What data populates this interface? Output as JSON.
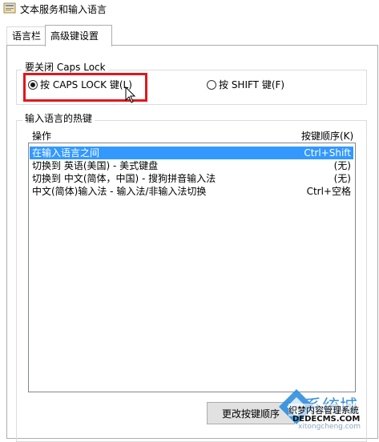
{
  "window": {
    "title": "文本服务和输入语言"
  },
  "tabs": [
    {
      "label": "语言栏",
      "active": false
    },
    {
      "label": "高级键设置",
      "active": true
    }
  ],
  "caps_lock_group": {
    "legend": "要关闭 Caps Lock",
    "option_caps": {
      "label": "按 CAPS LOCK 键(L)",
      "selected": true
    },
    "option_shift": {
      "label": "按 SHIFT 键(F)",
      "selected": false
    }
  },
  "hotkeys_group": {
    "legend": "输入语言的热键",
    "col_action": "操作",
    "col_sequence": "按键顺序(K)",
    "rows": [
      {
        "action": "在输入语言之间",
        "keys": "Ctrl+Shift",
        "selected": true
      },
      {
        "action": "切换到 英语(美国) - 美式键盘",
        "keys": "(无)",
        "selected": false
      },
      {
        "action": "切换到 中文(简体，中国) - 搜狗拼音输入法",
        "keys": "(无)",
        "selected": false
      },
      {
        "action": "中文(简体)输入法 - 输入法/非输入法切换",
        "keys": "Ctrl+空格",
        "selected": false
      }
    ]
  },
  "change_button": {
    "label": "更改按键顺序"
  },
  "watermark": {
    "brand_cn": "系统城",
    "brand_en": "xitongcheng.com",
    "site_cn": "织梦内容管理系统",
    "domain": "DEDECMS.COM"
  },
  "colors": {
    "selection": "#3399ff",
    "highlight_border": "#e0181c"
  }
}
